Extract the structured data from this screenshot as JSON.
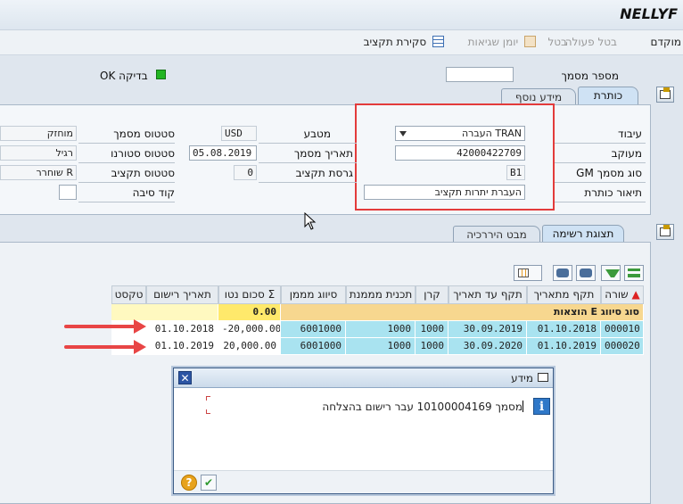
{
  "window": {
    "title": "NELLYF"
  },
  "toolbar": {
    "items": [
      {
        "label": "מוקדם",
        "disabled": false
      },
      {
        "label": "בטל פעולה",
        "disabled": true
      },
      {
        "label": "בטל",
        "disabled": true
      },
      {
        "label": "יומן שגיאות",
        "disabled": true
      },
      {
        "label": "סקירת תקציב",
        "disabled": false
      }
    ]
  },
  "header": {
    "doc_number_label": "מספר מסמך",
    "doc_number_value": "",
    "check_label": "בדיקה OK"
  },
  "tabs_top": [
    {
      "label": "כותרת"
    },
    {
      "label": "מידע נוסף"
    }
  ],
  "form": {
    "processing": {
      "label": "עיבוד",
      "value": "TRAN העברה"
    },
    "reference": {
      "label": "מעוקב",
      "value": "42000422709"
    },
    "gm_doc_type": {
      "label": "סוג מסמך GM",
      "value": "B1"
    },
    "header_desc": {
      "label": "תיאור כותרת",
      "value": "העברת יתרות תקציב"
    },
    "currency": {
      "label": "מטבע",
      "value": "USD"
    },
    "doc_date": {
      "label": "תאריך מסמך",
      "value": "05.08.2019"
    },
    "budget_version": {
      "label": "גרסת תקציב",
      "value": "0"
    },
    "doc_status": {
      "label": "סטטוס מסמך",
      "value": "מוחזק"
    },
    "reversal_status": {
      "label": "סטטוס סטורנו",
      "value": "רגיל"
    },
    "budget_status": {
      "label": "סטטוס תקציב",
      "value": "R שוחרר"
    },
    "reason_code": {
      "label": "קוד סיבה",
      "value": ""
    }
  },
  "tabs_bottom": [
    {
      "label": "תצוגת רשימה"
    },
    {
      "label": "מבט היררכיה"
    }
  ],
  "grid": {
    "columns": [
      "שורה",
      "תקף מתאריך",
      "תקף עד תאריך",
      "קרן",
      "תכנית מממנת",
      "סיווג מממן",
      "סכום נטו",
      "תאריך רישום",
      "טקסט"
    ],
    "group_label": "סוג סיווג E הוצאות",
    "group_total": "0.00",
    "rows": [
      {
        "line": "000010",
        "from": "01.10.2018",
        "to": "30.09.2019",
        "fund": "1000",
        "program": "1000",
        "classification": "6001000",
        "amount": "-20,000.00",
        "posting_date": "01.10.2018",
        "text": ""
      },
      {
        "line": "000020",
        "from": "01.10.2019",
        "to": "30.09.2020",
        "fund": "1000",
        "program": "1000",
        "classification": "6001000",
        "amount": "20,000.00",
        "posting_date": "01.10.2019",
        "text": ""
      }
    ]
  },
  "dialog": {
    "title": "מידע",
    "message": "מסמך 10100004169 עבר רישום בהצלחה"
  },
  "colors": {
    "highlight": "#e33b3b",
    "ok": "#22b522",
    "cyan_cells": "#a9e3f0",
    "group_row": "#f7d78f"
  }
}
